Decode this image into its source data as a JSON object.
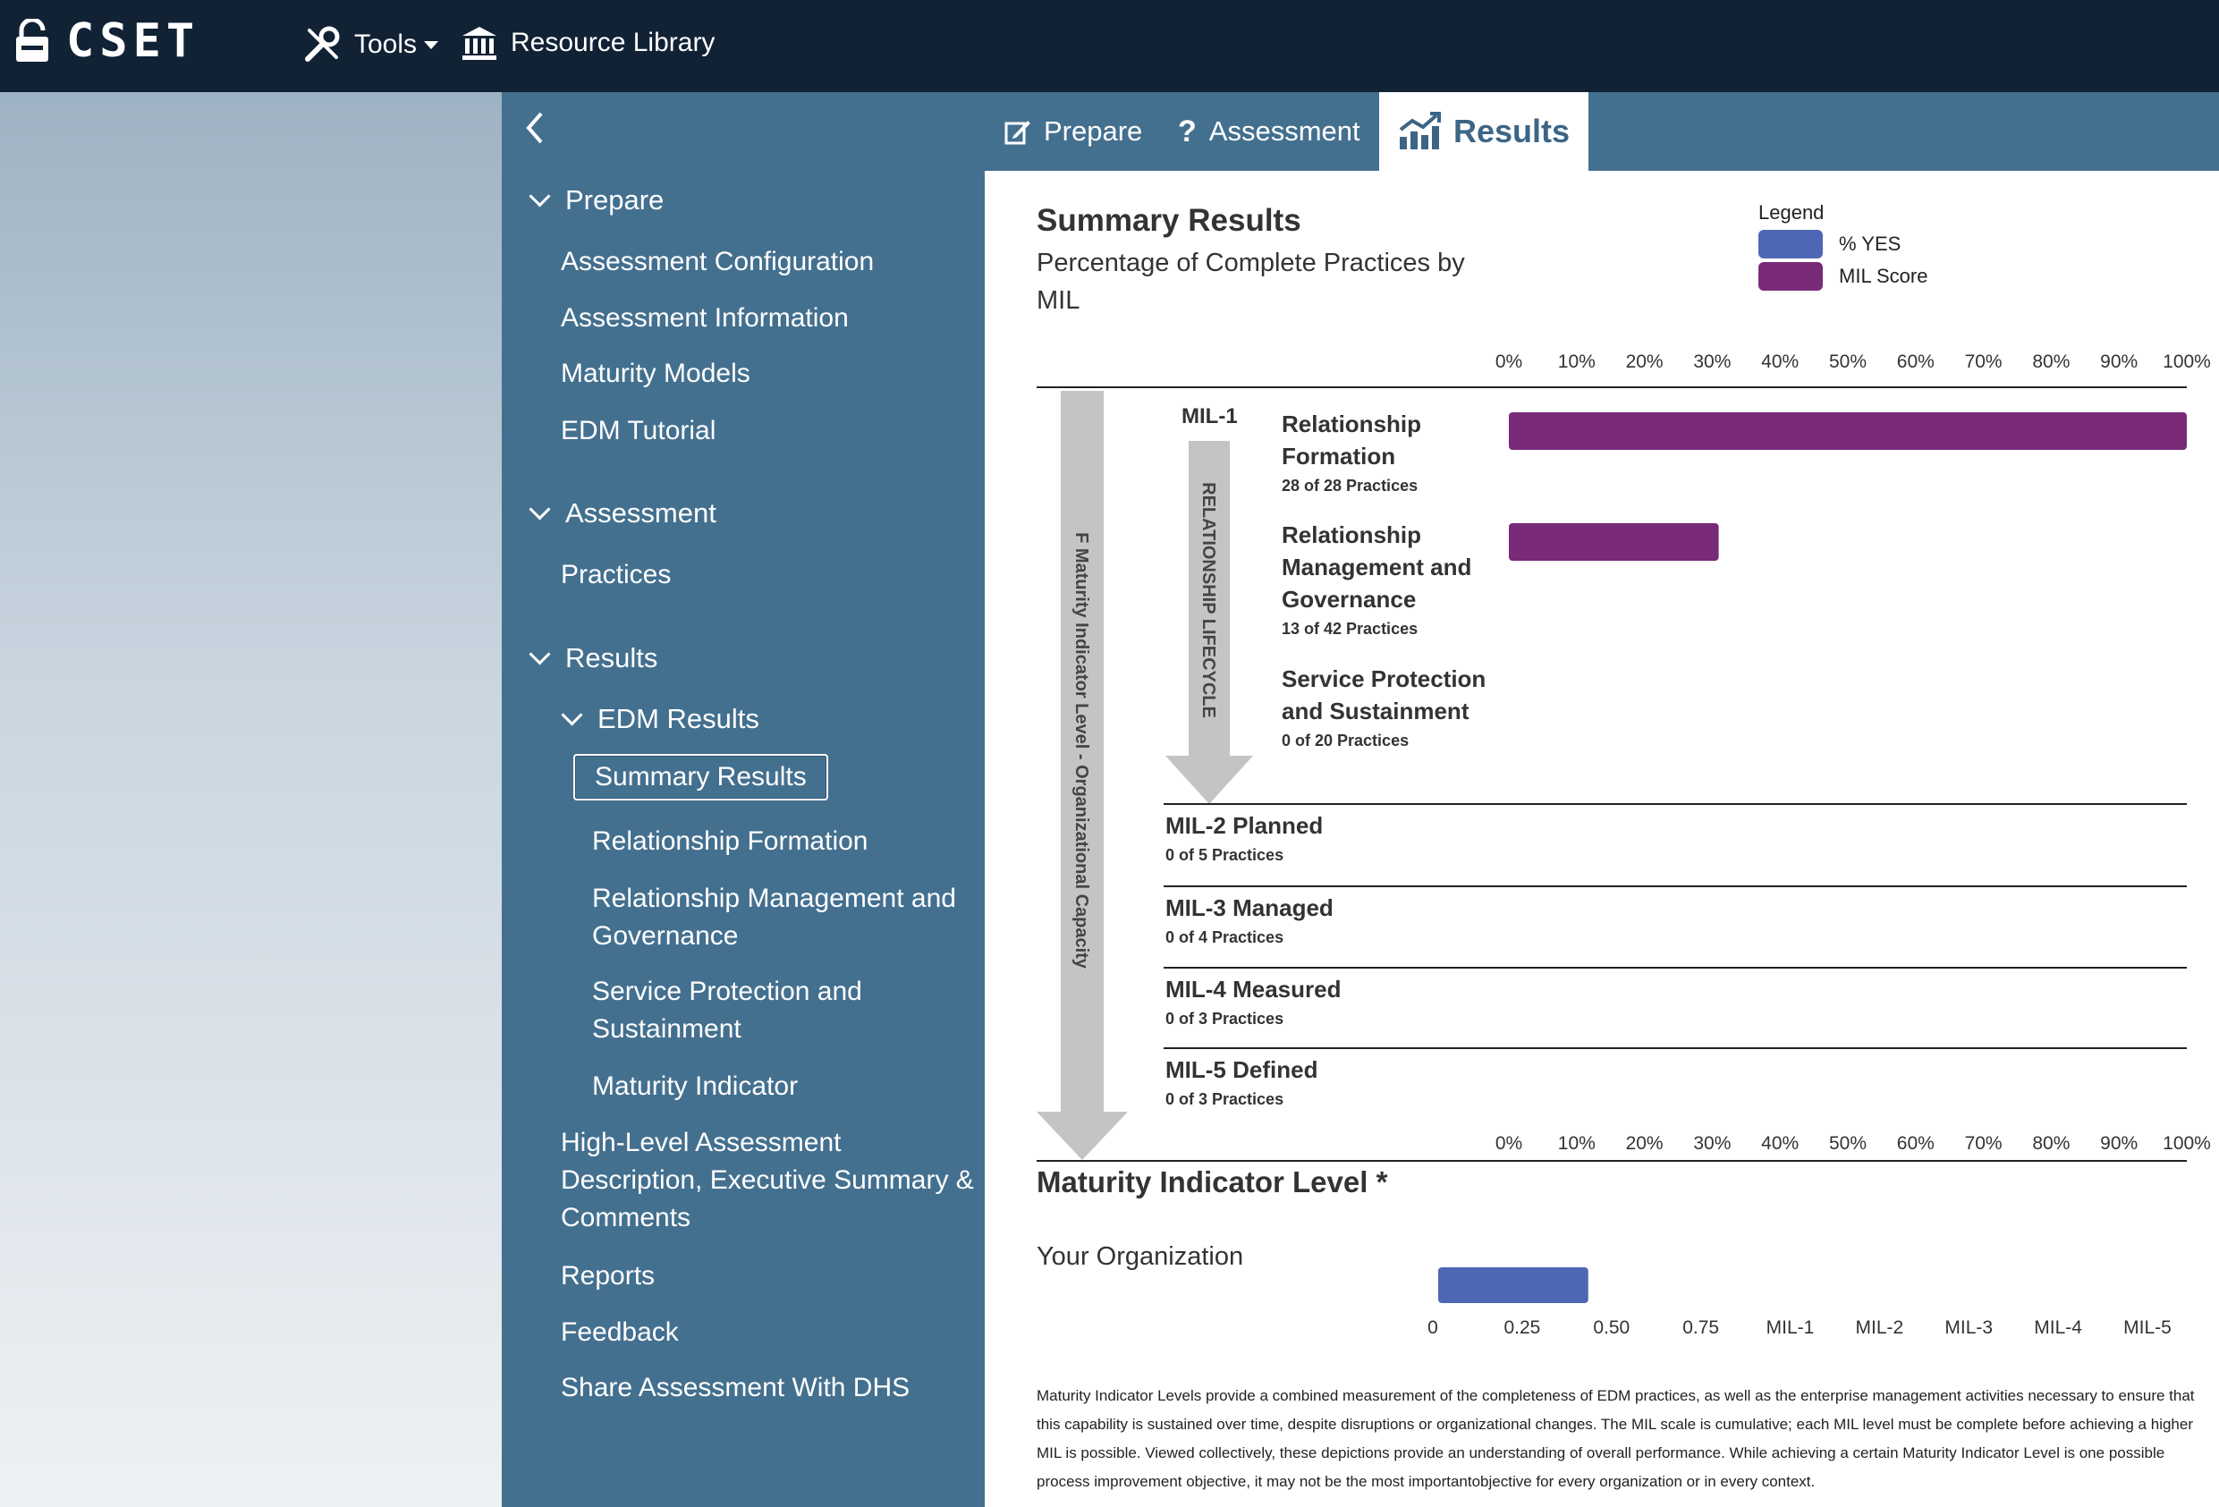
{
  "topbar": {
    "app_name": "CSET",
    "tools_label": "Tools",
    "library_label": "Resource Library"
  },
  "tabs": [
    {
      "label": "Prepare",
      "icon": "edit-icon"
    },
    {
      "label": "Assessment",
      "icon": "question-icon"
    },
    {
      "label": "Results",
      "icon": "chart-icon",
      "active": true
    }
  ],
  "sidebar": {
    "prepare": "Prepare",
    "assessment_configuration": "Assessment Configuration",
    "assessment_information": "Assessment Information",
    "maturity_models": "Maturity Models",
    "edm_tutorial": "EDM Tutorial",
    "assessment": "Assessment",
    "practices": "Practices",
    "results": "Results",
    "edm_results": "EDM Results",
    "summary_results": "Summary Results",
    "relationship_formation": "Relationship Formation",
    "rmg_line1": "Relationship Management and",
    "rmg_line2": "Governance",
    "sps_line1": "Service Protection and",
    "sps_line2": "Sustainment",
    "maturity_indicator": "Maturity Indicator",
    "hla_line1": "High-Level Assessment",
    "hla_line2": "Description, Executive Summary &",
    "hla_line3": "Comments",
    "reports": "Reports",
    "feedback": "Feedback",
    "share": "Share Assessment With DHS"
  },
  "main": {
    "title": "Summary Results",
    "subtitle_line1": "Percentage of Complete Practices by",
    "subtitle_line2": "MIL",
    "legend": {
      "title": "Legend",
      "items": [
        {
          "label": "% YES",
          "color": "#4e67b5"
        },
        {
          "label": "MIL Score",
          "color": "#792a79"
        }
      ]
    },
    "mil_section_title": "Maturity Indicator Level *",
    "your_org": "Your Organization",
    "footnote": "Maturity Indicator Levels provide a combined measurement of the completeness of EDM practices, as well as the enterprise management activities necessary to ensure that this capability is sustained over time, despite disruptions or organizational changes. The MIL scale is cumulative; each MIL level must be complete before achieving a higher MIL is possible. Viewed collectively, these depictions provide an understanding of overall performance. While achieving a certain Maturity Indicator Level is one possible process improvement objective, it may not be the most importantobjective for every organization or in every context."
  },
  "chart_data": [
    {
      "type": "bar",
      "orientation": "horizontal",
      "title": "Percentage of Complete Practices by MIL",
      "vertical_label_outer": "F Maturity Indicator Level - Organizational Capacity",
      "vertical_label_inner": "RELATIONSHIP LIFECYCLE",
      "mil1_label": "MIL-1",
      "x_ticks": [
        "0%",
        "10%",
        "20%",
        "30%",
        "40%",
        "50%",
        "60%",
        "70%",
        "80%",
        "90%",
        "100%"
      ],
      "xlim": [
        0,
        100
      ],
      "bar_color": "#792a79",
      "goals": [
        {
          "name_lines": [
            "Relationship",
            "Formation"
          ],
          "practices": "28 of 28 Practices",
          "value": 100
        },
        {
          "name_lines": [
            "Relationship",
            "Management and",
            "Governance"
          ],
          "practices": "13 of 42 Practices",
          "value": 30.95
        },
        {
          "name_lines": [
            "Service Protection",
            "and Sustainment"
          ],
          "practices": "0 of 20 Practices",
          "value": 0
        }
      ],
      "mil_levels": [
        {
          "name": "MIL-2 Planned",
          "practices": "0 of 5 Practices"
        },
        {
          "name": "MIL-3 Managed",
          "practices": "0 of 4 Practices"
        },
        {
          "name": "MIL-4 Measured",
          "practices": "0 of 3 Practices"
        },
        {
          "name": "MIL-5 Defined",
          "practices": "0 of 3 Practices"
        }
      ]
    },
    {
      "type": "bar",
      "orientation": "horizontal",
      "title": "Maturity Indicator Level *",
      "categories": [
        "Your Organization"
      ],
      "values": [
        0.45
      ],
      "bar_color": "#4e67b5",
      "x_ticks": [
        "0",
        "0.25",
        "0.50",
        "0.75",
        "MIL-1",
        "MIL-2",
        "MIL-3",
        "MIL-4",
        "MIL-5"
      ],
      "xlim": [
        0,
        2
      ]
    }
  ]
}
